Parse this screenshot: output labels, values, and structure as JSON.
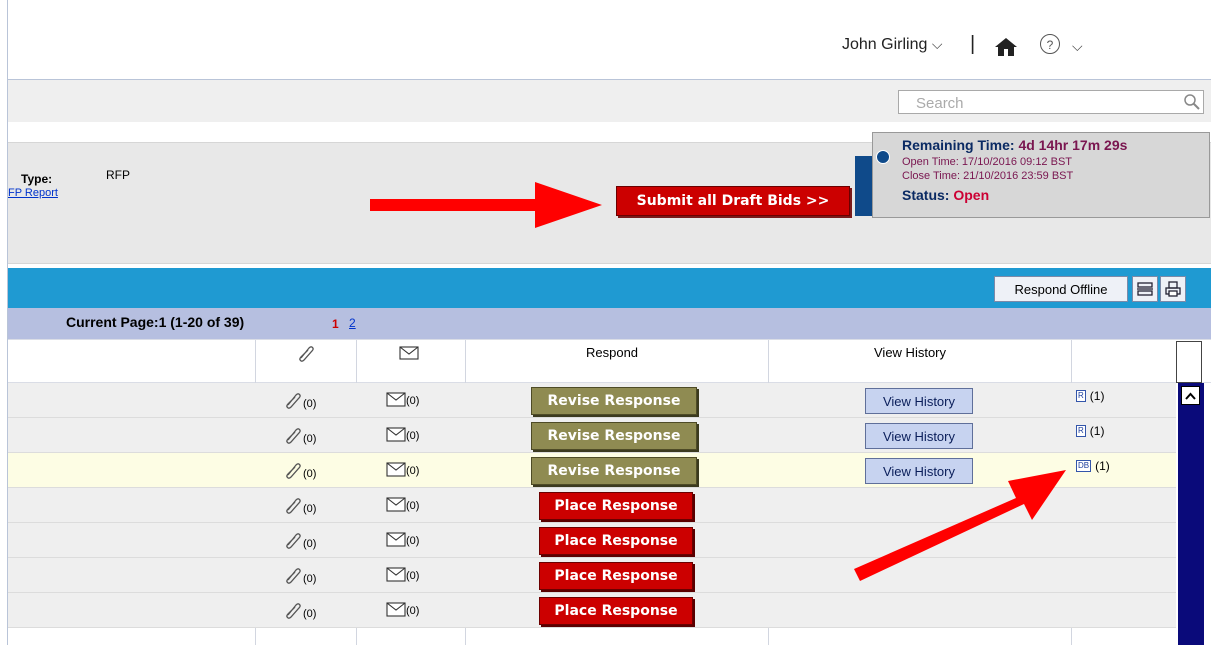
{
  "header": {
    "user_name": "John Girling",
    "user_chevron": "⌵",
    "separator": "|",
    "help_glyph": "?",
    "help_chevron": "⌵"
  },
  "search": {
    "placeholder": "Search"
  },
  "info": {
    "type_label": "Type:",
    "type_value": "RFP",
    "report_link": "FP Report",
    "submit_label": "Submit all Draft Bids >>"
  },
  "timer": {
    "remaining_label": "Remaining Time:",
    "remaining_value": "4d 14hr 17m 29s",
    "open_time": "Open Time: 17/10/2016 09:12 BST",
    "close_time": "Close Time: 21/10/2016 23:59 BST",
    "status_label": "Status:",
    "status_value": "Open"
  },
  "toolbar": {
    "respond_offline": "Respond Offline"
  },
  "paging": {
    "current": "Current Page:1  (1-20 of 39)",
    "page1": "1",
    "page2": "2"
  },
  "table": {
    "headers": {
      "respond": "Respond",
      "view_history": "View History"
    },
    "rows": [
      {
        "attachments": "(0)",
        "messages": "(0)",
        "action": "Revise Response",
        "history": "View History",
        "doc_icon": "R",
        "doc_count": "(1)"
      },
      {
        "attachments": "(0)",
        "messages": "(0)",
        "action": "Revise Response",
        "history": "View History",
        "doc_icon": "R",
        "doc_count": "(1)"
      },
      {
        "attachments": "(0)",
        "messages": "(0)",
        "action": "Revise Response",
        "history": "View History",
        "doc_icon": "DB",
        "doc_count": "(1)"
      },
      {
        "attachments": "(0)",
        "messages": "(0)",
        "action": "Place Response"
      },
      {
        "attachments": "(0)",
        "messages": "(0)",
        "action": "Place Response"
      },
      {
        "attachments": "(0)",
        "messages": "(0)",
        "action": "Place Response"
      },
      {
        "attachments": "(0)",
        "messages": "(0)",
        "action": "Place Response"
      }
    ]
  },
  "colors": {
    "accent_blue": "#1f9ad2",
    "primary_red": "#cc0000",
    "revise_olive": "#8f8b52",
    "paging_lavender": "#b6bfe0",
    "annotation_red": "#ff0000"
  }
}
